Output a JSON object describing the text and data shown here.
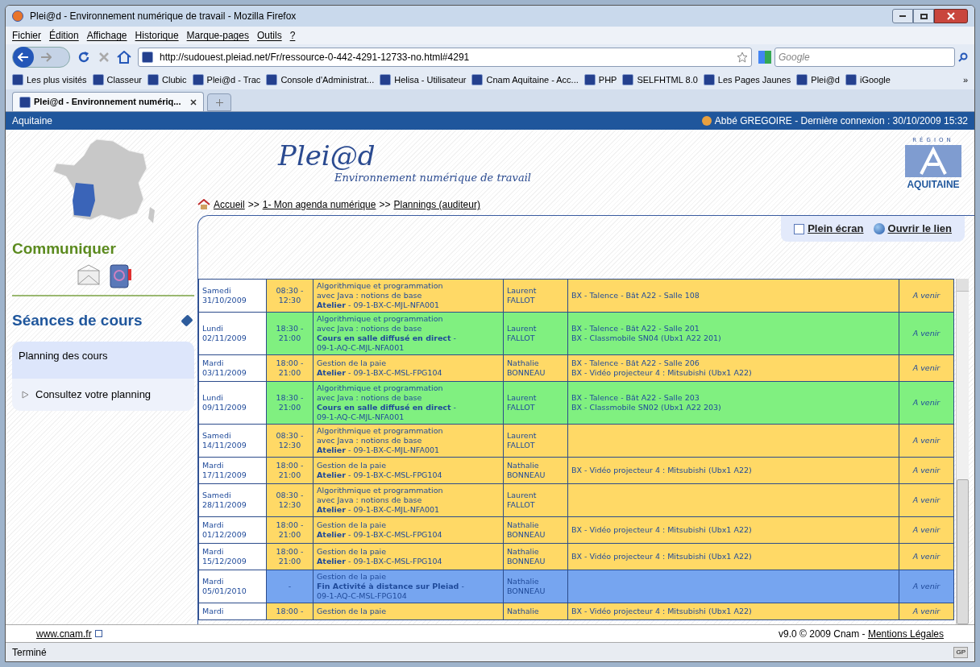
{
  "window": {
    "title": "Plei@d - Environnement numérique de travail - Mozilla Firefox"
  },
  "menu": [
    "Fichier",
    "Édition",
    "Affichage",
    "Historique",
    "Marque-pages",
    "Outils",
    "?"
  ],
  "address_bar": {
    "value": "http://sudouest.pleiad.net/Fr/ressource-0-442-4291-12733-no.html#4291"
  },
  "search": {
    "placeholder": "Google"
  },
  "bookmarks": [
    "Les plus visités",
    "Classeur",
    "Clubic",
    "Plei@d - Trac",
    "Console d'Administrat...",
    "Helisa - Utilisateur",
    "Cnam Aquitaine - Acc...",
    "PHP",
    "SELFHTML 8.0",
    "Les Pages Jaunes",
    "Plei@d",
    "iGoogle"
  ],
  "bookmarks_more": "»",
  "tabs": [
    {
      "label": "Plei@d - Environnement numériq...",
      "selected": true
    }
  ],
  "site_bar": {
    "region": "Aquitaine",
    "user": "Abbé GREGOIRE - Dernière connexion : 30/10/2009 15:32"
  },
  "logo": {
    "name": "Plei@d",
    "tagline": "Environnement numérique de travail"
  },
  "region_logo": {
    "top": "RÉGION",
    "bottom": "AQUITAINE"
  },
  "breadcrumb": [
    "Accueil",
    "1- Mon agenda numérique",
    "Plannings (auditeur)"
  ],
  "breadcrumb_separator": ">>",
  "actions": [
    "Plein écran",
    "Ouvrir le lien"
  ],
  "sidebar": {
    "communicate_title": "Communiquer",
    "sessions_title": "Séances de cours",
    "panel_title": "Planning des cours",
    "panel_link": "Consultez votre planning"
  },
  "rows": [
    {
      "color": "#ffd966",
      "day": "Samedi",
      "date": "31/10/2009",
      "time": [
        "08:30 -",
        "12:30"
      ],
      "course": [
        "Algorithmique et programmation",
        "avec Java : notions de base",
        "**Atelier** - 09-1-BX-C-MJL-NFA001"
      ],
      "teacher": [
        "Laurent",
        "FALLOT"
      ],
      "rooms": [
        "BX - Talence - Bât A22 - Salle 108"
      ],
      "status": "A venir"
    },
    {
      "color": "#80f080",
      "day": "Lundi",
      "date": "02/11/2009",
      "time": [
        "18:30 -",
        "21:00"
      ],
      "course": [
        "Algorithmique et programmation",
        "avec Java : notions de base",
        "**Cours en salle diffusé en direct** -",
        "09-1-AQ-C-MJL-NFA001"
      ],
      "teacher": [
        "Laurent",
        "FALLOT"
      ],
      "rooms": [
        "BX - Talence - Bât A22 - Salle 201",
        "BX - Classmobile SN04 (Ubx1 A22 201)"
      ],
      "status": "A venir"
    },
    {
      "color": "#ffd966",
      "day": "Mardi",
      "date": "03/11/2009",
      "time": [
        "18:00 -",
        "21:00"
      ],
      "course": [
        "Gestion de la paie",
        "**Atelier** - 09-1-BX-C-MSL-FPG104"
      ],
      "teacher": [
        "Nathalie",
        "BONNEAU"
      ],
      "rooms": [
        "BX - Talence - Bât A22 - Salle 206",
        "BX - Vidéo projecteur 4 : Mitsubishi (Ubx1 A22)"
      ],
      "status": "A venir"
    },
    {
      "color": "#80f080",
      "day": "Lundi",
      "date": "09/11/2009",
      "time": [
        "18:30 -",
        "21:00"
      ],
      "course": [
        "Algorithmique et programmation",
        "avec Java : notions de base",
        "**Cours en salle diffusé en direct** -",
        "09-1-AQ-C-MJL-NFA001"
      ],
      "teacher": [
        "Laurent",
        "FALLOT"
      ],
      "rooms": [
        "BX - Talence - Bât A22 - Salle 203",
        "BX - Classmobile SN02 (Ubx1 A22 203)"
      ],
      "status": "A venir"
    },
    {
      "color": "#ffd966",
      "day": "Samedi",
      "date": "14/11/2009",
      "time": [
        "08:30 -",
        "12:30"
      ],
      "course": [
        "Algorithmique et programmation",
        "avec Java : notions de base",
        "**Atelier** - 09-1-BX-C-MJL-NFA001"
      ],
      "teacher": [
        "Laurent",
        "FALLOT"
      ],
      "rooms": [],
      "status": "A venir"
    },
    {
      "color": "#ffd966",
      "day": "Mardi",
      "date": "17/11/2009",
      "time": [
        "18:00 -",
        "21:00"
      ],
      "course": [
        "Gestion de la paie",
        "**Atelier** - 09-1-BX-C-MSL-FPG104"
      ],
      "teacher": [
        "Nathalie",
        "BONNEAU"
      ],
      "rooms": [
        "BX - Vidéo projecteur 4 : Mitsubishi (Ubx1 A22)"
      ],
      "status": "A venir"
    },
    {
      "color": "#ffd966",
      "day": "Samedi",
      "date": "28/11/2009",
      "time": [
        "08:30 -",
        "12:30"
      ],
      "course": [
        "Algorithmique et programmation",
        "avec Java : notions de base",
        "**Atelier** - 09-1-BX-C-MJL-NFA001"
      ],
      "teacher": [
        "Laurent",
        "FALLOT"
      ],
      "rooms": [],
      "status": "A venir"
    },
    {
      "color": "#ffd966",
      "day": "Mardi",
      "date": "01/12/2009",
      "time": [
        "18:00 -",
        "21:00"
      ],
      "course": [
        "Gestion de la paie",
        "**Atelier** - 09-1-BX-C-MSL-FPG104"
      ],
      "teacher": [
        "Nathalie",
        "BONNEAU"
      ],
      "rooms": [
        "BX - Vidéo projecteur 4 : Mitsubishi (Ubx1 A22)"
      ],
      "status": "A venir"
    },
    {
      "color": "#ffd966",
      "day": "Mardi",
      "date": "15/12/2009",
      "time": [
        "18:00 -",
        "21:00"
      ],
      "course": [
        "Gestion de la paie",
        "**Atelier** - 09-1-BX-C-MSL-FPG104"
      ],
      "teacher": [
        "Nathalie",
        "BONNEAU"
      ],
      "rooms": [
        "BX - Vidéo projecteur 4 : Mitsubishi (Ubx1 A22)"
      ],
      "status": "A venir"
    },
    {
      "color": "#76a5f0",
      "day": "Mardi",
      "date": "05/01/2010",
      "time": [
        "-"
      ],
      "course": [
        "Gestion de la paie",
        "**Fin Activité à distance sur Pleiad** -",
        "09-1-AQ-C-MSL-FPG104"
      ],
      "teacher": [
        "Nathalie",
        "BONNEAU"
      ],
      "rooms": [],
      "status": "A venir"
    },
    {
      "color": "#ffd966",
      "day": "Mardi",
      "date": "",
      "time": [
        "18:00 -"
      ],
      "course": [
        "Gestion de la paie"
      ],
      "teacher": [
        "Nathalie"
      ],
      "rooms": [
        "BX - Vidéo projecteur 4 : Mitsubishi (Ubx1 A22)"
      ],
      "status": "A venir"
    }
  ],
  "footer": {
    "link": "www.cnam.fr",
    "version": "v9.0 © 2009 Cnam - ",
    "legal": "Mentions Légales"
  },
  "status_bar": {
    "text": "Terminé",
    "badge": "GP"
  }
}
